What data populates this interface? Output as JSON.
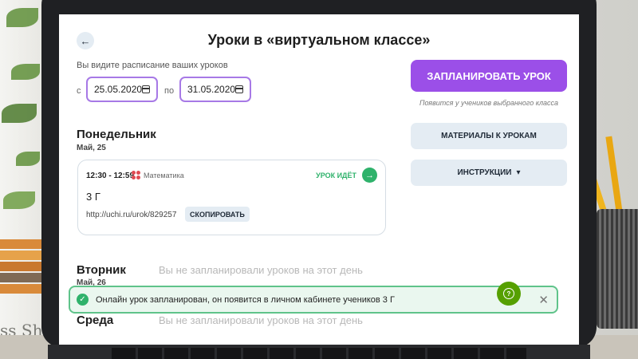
{
  "header": {
    "back_icon": "arrow-left-icon",
    "title": "Уроки в «виртуальном классе»"
  },
  "schedule": {
    "subtitle": "Вы видите расписание ваших уроков",
    "from_label": "с",
    "from_date": "25.05.2020",
    "to_label": "по",
    "to_date": "31.05.2020",
    "calendar_icon": "calendar-icon"
  },
  "days": [
    {
      "name": "Понедельник",
      "date": "Май, 25",
      "lessons": [
        {
          "time": "12:30 - 12:59",
          "subject": "Математика",
          "subject_icon": "math-icon",
          "status": "УРОК ИДЁТ",
          "status_icon": "arrow-right-icon",
          "class_name": "3 Г",
          "link": "http://uchi.ru/urok/829257",
          "copy_label": "СКОПИРОВАТЬ"
        }
      ]
    },
    {
      "name": "Вторник",
      "date": "Май, 26",
      "empty_text": "Вы не запланировали уроков на этот день"
    },
    {
      "name": "Среда",
      "empty_text": "Вы не запланировали уроков на этот день"
    }
  ],
  "actions": {
    "plan_button": "ЗАПЛАНИРОВАТЬ УРОК",
    "plan_hint": "Появится у учеников выбранного класса",
    "materials_button": "МАТЕРИАЛЫ К УРОКАМ",
    "instructions_button": "ИНСТРУКЦИИ",
    "instructions_icon": "chevron-down-icon"
  },
  "toast": {
    "icon": "check-circle-icon",
    "message": "Онлайн урок запланирован, он появится в личном кабинете учеников 3 Г",
    "close_icon": "close-icon"
  },
  "help": {
    "icon": "help-icon",
    "glyph": "?"
  },
  "background": {
    "book_text": "ss Sh"
  },
  "colors": {
    "accent": "#9b4fe8",
    "success": "#2fb26b",
    "secondary_bg": "#e4ecf3",
    "help": "#56a000"
  }
}
